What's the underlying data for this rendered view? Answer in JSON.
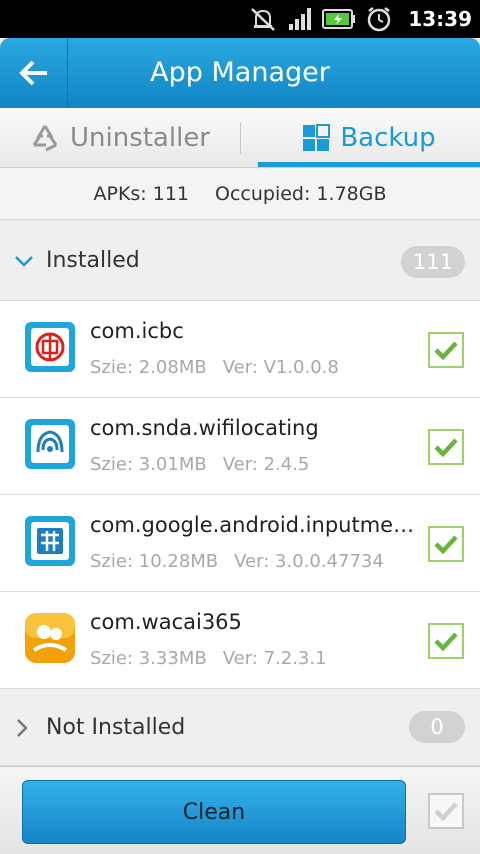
{
  "status_bar": {
    "time": "13:39"
  },
  "header": {
    "title": "App Manager"
  },
  "tabs": [
    {
      "label": "Uninstaller",
      "active": false
    },
    {
      "label": "Backup",
      "active": true
    }
  ],
  "summary": {
    "apks": "APKs: 111",
    "occupied": "Occupied: 1.78GB"
  },
  "installed": {
    "label": "Installed",
    "count": "111"
  },
  "apps": [
    {
      "name": "com.icbc",
      "size": "Szie: 2.08MB",
      "ver": "Ver: V1.0.0.8",
      "checked": true
    },
    {
      "name": "com.snda.wifilocating",
      "size": "Szie: 3.01MB",
      "ver": "Ver: 2.4.5",
      "checked": true
    },
    {
      "name": "com.google.android.inputmethod.pinyin",
      "size": "Szie: 10.28MB",
      "ver": "Ver: 3.0.0.47734",
      "checked": true
    },
    {
      "name": "com.wacai365",
      "size": "Szie: 3.33MB",
      "ver": "Ver: 7.2.3.1",
      "checked": true
    }
  ],
  "not_installed": {
    "label": "Not Installed",
    "count": "0"
  },
  "bottom": {
    "clean_label": "Clean"
  },
  "colors": {
    "accent": "#1a9ad6",
    "check": "#6ab43c",
    "header": "#1b95d3"
  }
}
